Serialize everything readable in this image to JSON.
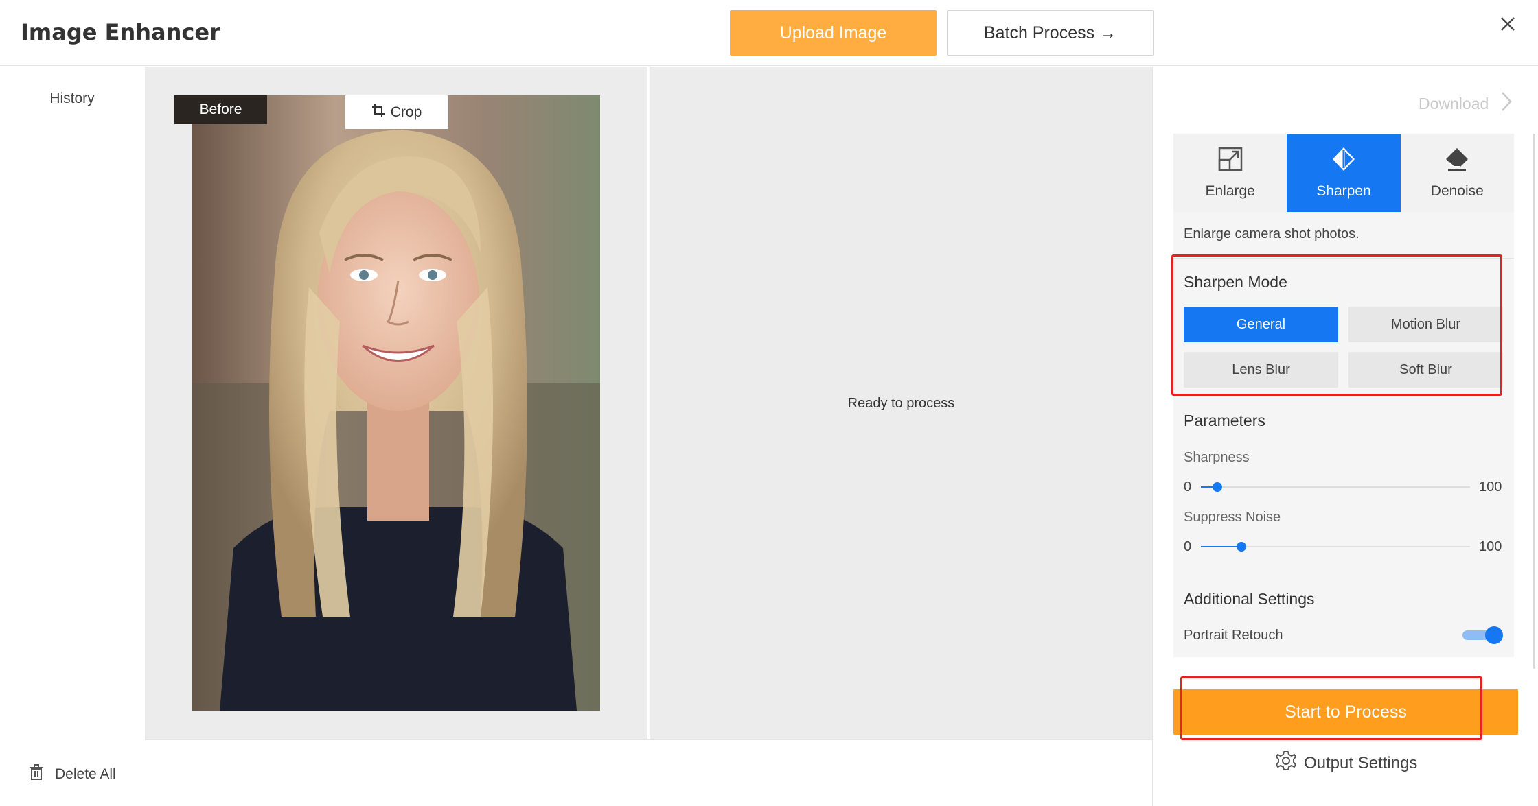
{
  "header": {
    "title": "Image Enhancer",
    "upload_label": "Upload Image",
    "batch_label": "Batch Process →"
  },
  "sidebar": {
    "title": "History",
    "delete_all_label": "Delete All"
  },
  "canvas": {
    "before_label": "Before",
    "crop_label": "Crop",
    "ready_text": "Ready to process"
  },
  "panel": {
    "download_label": "Download",
    "tabs": [
      {
        "label": "Enlarge",
        "icon": "enlarge-icon",
        "active": false
      },
      {
        "label": "Sharpen",
        "icon": "sharpen-icon",
        "active": true
      },
      {
        "label": "Denoise",
        "icon": "eraser-icon",
        "active": false
      }
    ],
    "description": "Enlarge camera shot photos.",
    "sharpen_mode": {
      "title": "Sharpen Mode",
      "options": [
        "General",
        "Motion Blur",
        "Lens Blur",
        "Soft Blur"
      ],
      "selected": "General"
    },
    "parameters": {
      "title": "Parameters",
      "sharpness": {
        "label": "Sharpness",
        "min": "0",
        "max": "100",
        "value": 6
      },
      "suppress_noise": {
        "label": "Suppress Noise",
        "min": "0",
        "max": "100",
        "value": 15
      }
    },
    "additional": {
      "title": "Additional Settings",
      "portrait_retouch_label": "Portrait Retouch",
      "portrait_retouch_on": true
    },
    "start_label": "Start to Process",
    "output_settings_label": "Output Settings"
  },
  "colors": {
    "accent_orange": "#ffac40",
    "start_orange": "#ff9d1f",
    "active_blue": "#1677f2",
    "annotation_red": "#e52222"
  }
}
